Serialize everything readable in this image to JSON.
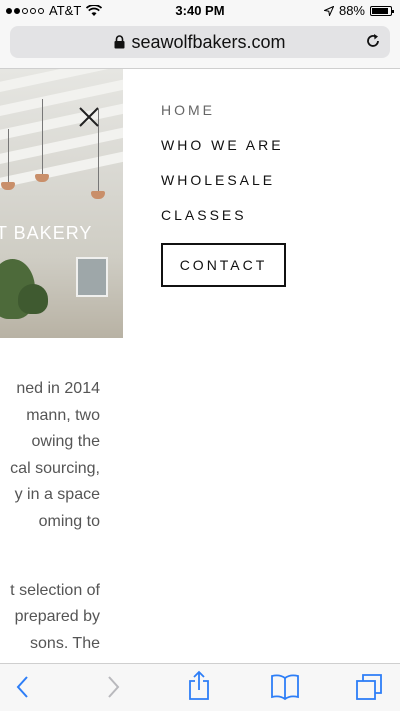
{
  "status_bar": {
    "carrier": "AT&T",
    "time": "3:40 PM",
    "battery": "88%",
    "battery_level": 0.88,
    "signal_bars_filled": 2,
    "icons": [
      "signal-dots-icon",
      "wifi-icon",
      "location-arrow-icon",
      "battery-icon"
    ]
  },
  "browser": {
    "url": "seawolfbakers.com",
    "icons": [
      "lock-icon",
      "reload-icon"
    ]
  },
  "hero": {
    "partial_title": "T BAKERY",
    "close_icon": "close-icon"
  },
  "menu": {
    "items": [
      {
        "label": "HOME"
      },
      {
        "label": "WHO WE ARE"
      },
      {
        "label": "WHOLESALE"
      },
      {
        "label": "CLASSES"
      }
    ],
    "contact_label": "CONTACT"
  },
  "body": {
    "paragraph1": [
      "ned in 2014",
      "mann, two",
      "owing the",
      "cal sourcing,",
      "y in a space",
      "oming to"
    ],
    "paragraph2": [
      "t selection of",
      "prepared by",
      "sons.  The"
    ]
  },
  "toolbar": {
    "icons": [
      "back-icon",
      "forward-icon",
      "share-icon",
      "bookmarks-icon",
      "tabs-icon"
    ]
  },
  "colors": {
    "accent_blue": "#2d7ef7",
    "text_dark": "#111111",
    "text_body": "#555555"
  }
}
